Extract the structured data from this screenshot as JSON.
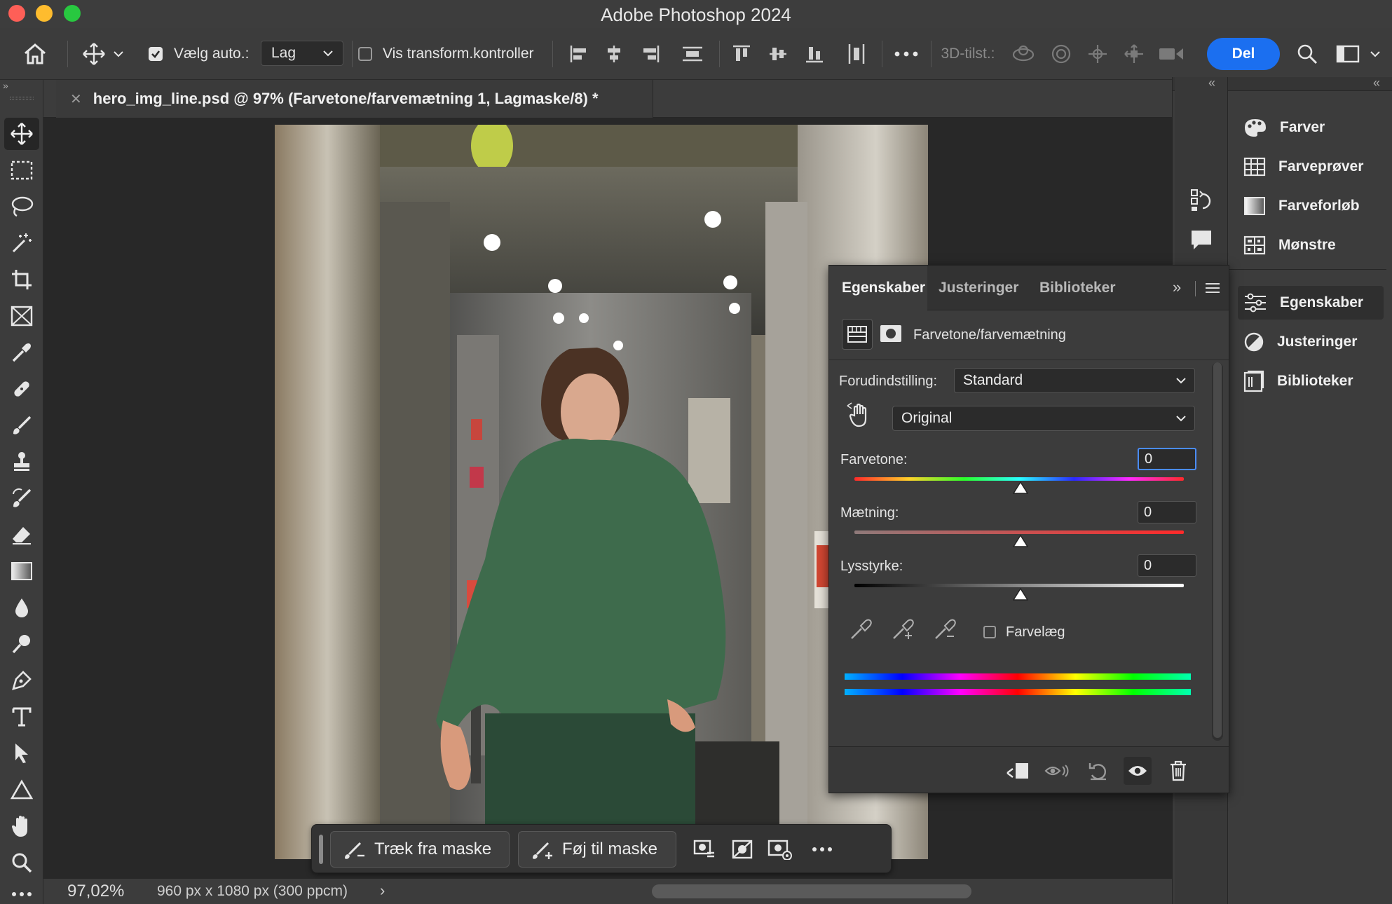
{
  "app": {
    "title": "Adobe Photoshop 2024",
    "traffic_colors": [
      "#fe5f57",
      "#febc2e",
      "#28c840"
    ]
  },
  "options_bar": {
    "auto_select_label": "Vælg auto.:",
    "auto_select_checked": true,
    "auto_select_target": "Lag",
    "transform_label": "Vis transform.kontroller",
    "transform_checked": false,
    "mode_3d_label": "3D-tilst.:",
    "share_label": "Del",
    "accent": "#1b6ff0"
  },
  "document": {
    "tab_title": "hero_img_line.psd @ 97% (Farvetone/farvemætning 1, Lagmaske/8) *"
  },
  "context_taskbar": {
    "subtract_label": "Træk fra maske",
    "add_label": "Føj til maske"
  },
  "status": {
    "zoom": "97,02%",
    "doc_size": "960 px x 1080 px (300 ppcm)"
  },
  "right_panels": {
    "items": [
      {
        "label": "Farver",
        "icon": "palette-icon"
      },
      {
        "label": "Farveprøver",
        "icon": "swatches-icon"
      },
      {
        "label": "Farveforløb",
        "icon": "gradient-icon"
      },
      {
        "label": "Mønstre",
        "icon": "patterns-icon"
      },
      {
        "label": "Egenskaber",
        "icon": "properties-icon"
      },
      {
        "label": "Justeringer",
        "icon": "adjustments-icon"
      },
      {
        "label": "Biblioteker",
        "icon": "libraries-icon"
      }
    ]
  },
  "properties": {
    "tabs": [
      "Egenskaber",
      "Justeringer",
      "Biblioteker"
    ],
    "active_tab": "Egenskaber",
    "adjustment_name": "Farvetone/farvemætning",
    "preset_label": "Forudindstilling:",
    "preset_value": "Standard",
    "channel_value": "Original",
    "hue_label": "Farvetone:",
    "hue_value": "0",
    "saturation_label": "Mætning:",
    "saturation_value": "0",
    "lightness_label": "Lysstyrke:",
    "lightness_value": "0",
    "colorize_label": "Farvelæg",
    "colorize_checked": false
  }
}
